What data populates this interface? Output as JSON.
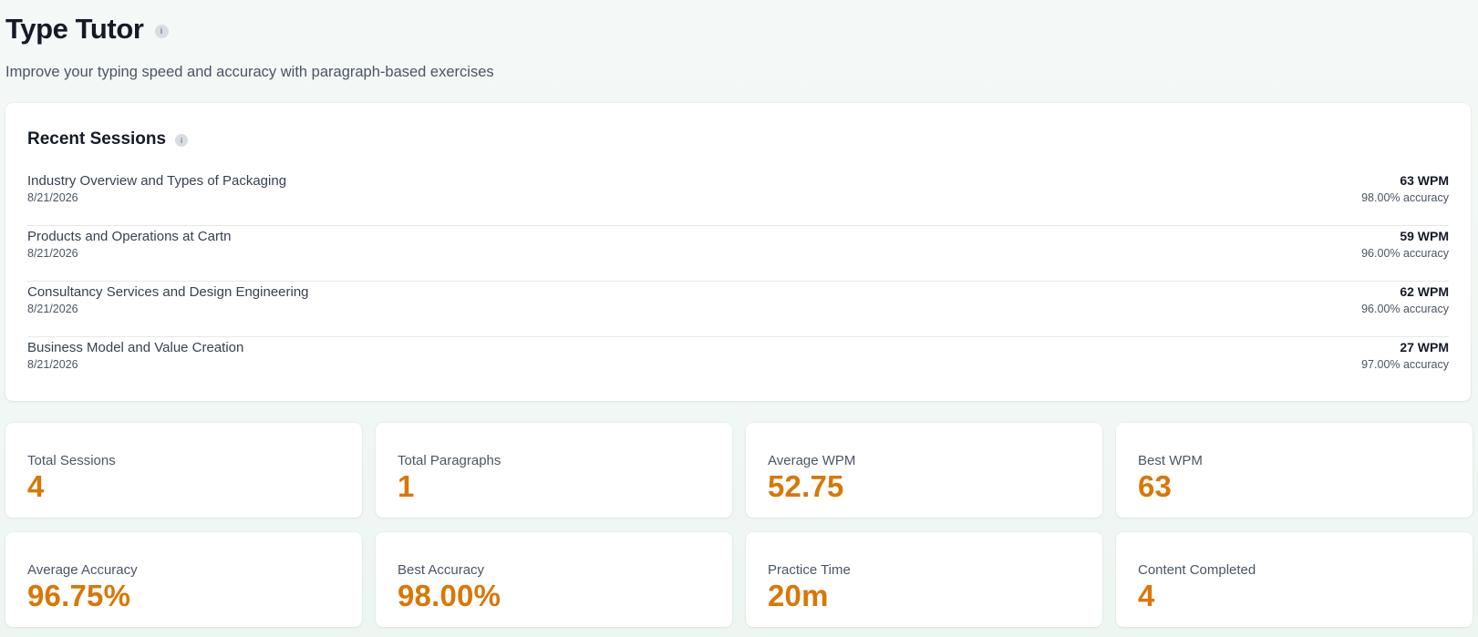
{
  "header": {
    "title": "Type Tutor",
    "info_glyph": "i",
    "subtitle": "Improve your typing speed and accuracy with paragraph-based exercises"
  },
  "recent_sessions": {
    "title": "Recent Sessions",
    "info_glyph": "i",
    "items": [
      {
        "name": "Industry Overview and Types of Packaging",
        "date": "8/21/2026",
        "wpm": "63 WPM",
        "accuracy": "98.00% accuracy"
      },
      {
        "name": "Products and Operations at Cartn",
        "date": "8/21/2026",
        "wpm": "59 WPM",
        "accuracy": "96.00% accuracy"
      },
      {
        "name": "Consultancy Services and Design Engineering",
        "date": "8/21/2026",
        "wpm": "62 WPM",
        "accuracy": "96.00% accuracy"
      },
      {
        "name": "Business Model and Value Creation",
        "date": "8/21/2026",
        "wpm": "27 WPM",
        "accuracy": "97.00% accuracy"
      }
    ]
  },
  "stats": [
    {
      "label": "Total Sessions",
      "value": "4"
    },
    {
      "label": "Total Paragraphs",
      "value": "1"
    },
    {
      "label": "Average WPM",
      "value": "52.75"
    },
    {
      "label": "Best WPM",
      "value": "63"
    },
    {
      "label": "Average Accuracy",
      "value": "96.75%"
    },
    {
      "label": "Best Accuracy",
      "value": "98.00%"
    },
    {
      "label": "Practice Time",
      "value": "20m"
    },
    {
      "label": "Content Completed",
      "value": "4"
    }
  ],
  "colors": {
    "accent": "#d97706",
    "title": "#141a26",
    "muted": "#4b5563"
  }
}
